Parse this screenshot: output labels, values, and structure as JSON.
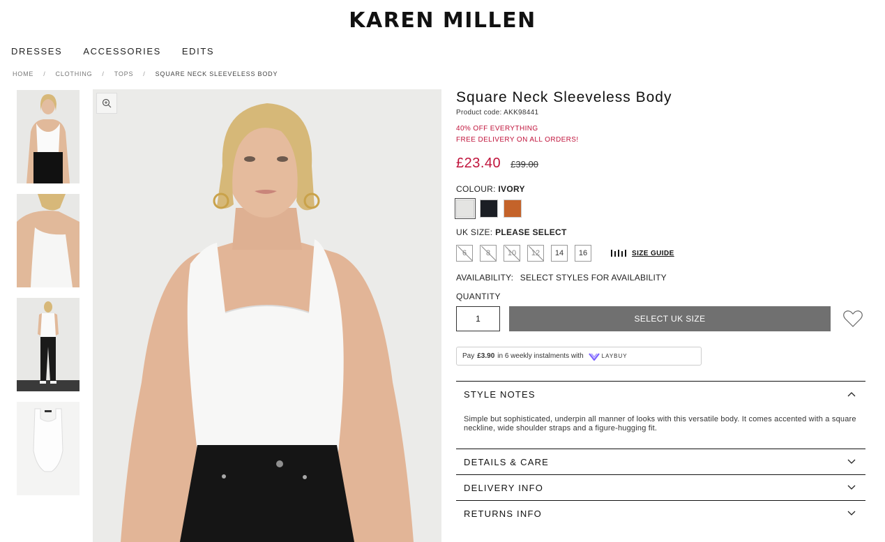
{
  "brand": "KAREN MILLEN",
  "nav": [
    "DRESSES",
    "ACCESSORIES",
    "EDITS"
  ],
  "breadcrumb": [
    "HOME",
    "CLOTHING",
    "TOPS",
    "SQUARE NECK SLEEVELESS BODY"
  ],
  "breadcrumb_separator": "/",
  "product": {
    "title": "Square Neck Sleeveless Body",
    "code": "Product code: AKK98441",
    "promo_1": "40% OFF EVERYTHING",
    "promo_2": "FREE DELIVERY ON ALL ORDERS!",
    "price_now": "£23.40",
    "price_was": "£39.00",
    "colour_label": "COLOUR:",
    "colour_value": "IVORY",
    "colours": [
      "#e4e4e2",
      "#1b1e24",
      "#c4632a"
    ],
    "size_label": "UK SIZE:",
    "size_value": "PLEASE SELECT",
    "sizes": [
      "6",
      "8",
      "10",
      "12",
      "14",
      "16"
    ],
    "size_guide": "SIZE GUIDE",
    "availability_label": "AVAILABILITY:",
    "availability_value": "SELECT STYLES FOR AVAILABILITY",
    "quantity_label": "QUANTITY",
    "quantity_value": "1",
    "add_button": "SELECT UK SIZE",
    "laybuy_pre": "Pay",
    "laybuy_amount": "£3.90",
    "laybuy_post": "in 6 weekly instalments with",
    "laybuy_brand": "LAYBUY"
  },
  "accordion": {
    "style_notes_title": "STYLE NOTES",
    "style_notes_body": "Simple but sophisticated, underpin all manner of looks with this versatile body. It comes accented with a square neckline, wide shoulder straps and a figure-hugging fit.",
    "details_title": "DETAILS & CARE",
    "delivery_title": "DELIVERY INFO",
    "returns_title": "RETURNS INFO"
  },
  "colors": {
    "sale_red": "#c0143c",
    "button_grey": "#707070"
  }
}
